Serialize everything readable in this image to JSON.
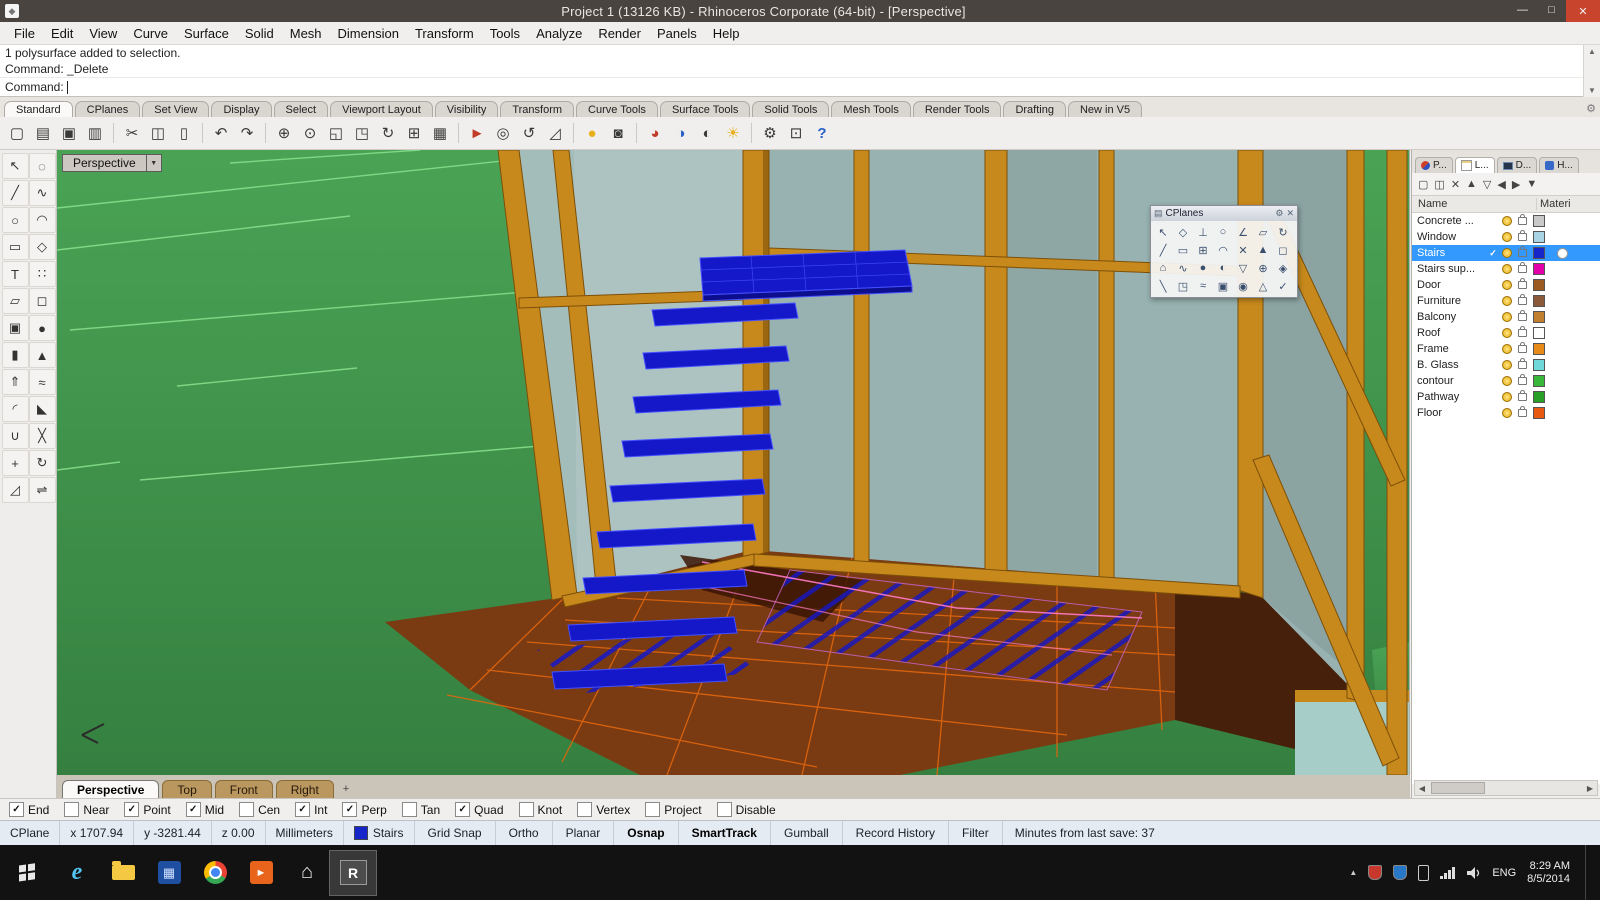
{
  "colors": {
    "titlebar": "#4a4441",
    "close": "#c8442c",
    "select": "#3399ff",
    "status-bg": "#e4ebf2",
    "taskbar": "#121212",
    "terrain": "#3f9048",
    "terrain-line": "#8ae28e",
    "glass": "#a3bdbb",
    "glass2": "#97b2b0",
    "wood": "#c8891c",
    "wood-dark": "#7c4f08",
    "floor": "#7a3a12",
    "floor-dark": "#46200a",
    "floor-line": "#e0660e",
    "stair": "#1518c8",
    "stair-edge": "#4550ff",
    "stair-dark": "#0c0e8e",
    "teal": "#a7cdc8",
    "pink": "#ff7ac8"
  },
  "window": {
    "title": "Project 1 (13126 KB) - Rhinoceros Corporate (64-bit) - [Perspective]",
    "controls": {
      "minimize": "—",
      "maximize": "□",
      "close": "✕"
    }
  },
  "menu": {
    "items": [
      "File",
      "Edit",
      "View",
      "Curve",
      "Surface",
      "Solid",
      "Mesh",
      "Dimension",
      "Transform",
      "Tools",
      "Analyze",
      "Render",
      "Panels",
      "Help"
    ]
  },
  "command": {
    "history": [
      "1 polysurface added to selection.",
      "Command: _Delete"
    ],
    "prompt": "Command:",
    "scroll_up": "▲",
    "scroll_down": "▼"
  },
  "toolbar_tabs": {
    "items": [
      "Standard",
      "CPlanes",
      "Set View",
      "Display",
      "Select",
      "Viewport Layout",
      "Visibility",
      "Transform",
      "Curve Tools",
      "Surface Tools",
      "Solid Tools",
      "Mesh Tools",
      "Render Tools",
      "Drafting",
      "New in V5"
    ],
    "active": "Standard",
    "options_glyph": "⚙"
  },
  "toolbar_icons": [
    {
      "name": "new-file-icon",
      "glyph": "▢"
    },
    {
      "name": "open-file-icon",
      "glyph": "▤"
    },
    {
      "name": "save-icon",
      "glyph": "▣"
    },
    {
      "name": "print-icon",
      "glyph": "▥"
    },
    {
      "name": "separator",
      "sep": true
    },
    {
      "name": "cut-icon",
      "glyph": "✂"
    },
    {
      "name": "copy-icon",
      "glyph": "◫"
    },
    {
      "name": "paste-icon",
      "glyph": "▯"
    },
    {
      "name": "separator",
      "sep": true
    },
    {
      "name": "undo-icon",
      "glyph": "↶"
    },
    {
      "name": "redo-icon",
      "glyph": "↷"
    },
    {
      "name": "separator",
      "sep": true
    },
    {
      "name": "pan-icon",
      "glyph": "⊕"
    },
    {
      "name": "zoom-icon",
      "glyph": "⊙"
    },
    {
      "name": "zoom-window-icon",
      "glyph": "◱"
    },
    {
      "name": "zoom-extents-icon",
      "glyph": "◳"
    },
    {
      "name": "rotate-view-icon",
      "glyph": "↻"
    },
    {
      "name": "viewport-layout-icon",
      "glyph": "⊞"
    },
    {
      "name": "named-cplane-icon",
      "glyph": "▦"
    },
    {
      "name": "separator",
      "sep": true
    },
    {
      "name": "move-icon",
      "glyph": "►",
      "cls": "red"
    },
    {
      "name": "copy-object-icon",
      "glyph": "◎"
    },
    {
      "name": "rotate-icon",
      "glyph": "↺"
    },
    {
      "name": "scale-icon",
      "glyph": "◿"
    },
    {
      "name": "separator",
      "sep": true
    },
    {
      "name": "lamp-icon",
      "glyph": "●",
      "cls": "yellow"
    },
    {
      "name": "lock-icon",
      "glyph": "◙"
    },
    {
      "name": "separator",
      "sep": true
    },
    {
      "name": "render-icon",
      "glyph": "◕",
      "cls": "red"
    },
    {
      "name": "render-preview-icon",
      "glyph": "◑",
      "cls": "blue"
    },
    {
      "name": "shaded-view-icon",
      "glyph": "◐"
    },
    {
      "name": "sun-icon",
      "glyph": "☀",
      "cls": "yellow"
    },
    {
      "name": "separator",
      "sep": true
    },
    {
      "name": "gear-icon",
      "glyph": "⚙"
    },
    {
      "name": "grid-options-icon",
      "glyph": "⊡"
    },
    {
      "name": "help-icon",
      "glyph": "?",
      "cls": "blue"
    }
  ],
  "left_tool_icons": [
    {
      "name": "pointer-icon",
      "glyph": "↖"
    },
    {
      "name": "lasso-select-icon",
      "glyph": "◌"
    },
    {
      "name": "polyline-icon",
      "glyph": "╱"
    },
    {
      "name": "control-curve-icon",
      "glyph": "∿"
    },
    {
      "name": "circle-icon",
      "glyph": "○"
    },
    {
      "name": "arc-icon",
      "glyph": "◠"
    },
    {
      "name": "rectangle-icon",
      "glyph": "▭"
    },
    {
      "name": "polygon-icon",
      "glyph": "◇"
    },
    {
      "name": "text-icon",
      "glyph": "T"
    },
    {
      "name": "points-icon",
      "glyph": "∷"
    },
    {
      "name": "surface-icon",
      "glyph": "▱"
    },
    {
      "name": "plane-icon",
      "glyph": "◻"
    },
    {
      "name": "box-icon",
      "glyph": "▣"
    },
    {
      "name": "sphere-icon",
      "glyph": "●"
    },
    {
      "name": "cylinder-icon",
      "glyph": "▮"
    },
    {
      "name": "cone-icon",
      "glyph": "▲"
    },
    {
      "name": "extrude-icon",
      "glyph": "⇑"
    },
    {
      "name": "loft-icon",
      "glyph": "≈"
    },
    {
      "name": "fillet-icon",
      "glyph": "◜"
    },
    {
      "name": "chamfer-icon",
      "glyph": "◣"
    },
    {
      "name": "boolean-union-icon",
      "glyph": "∪"
    },
    {
      "name": "trim-icon",
      "glyph": "╳"
    },
    {
      "name": "move-icon",
      "glyph": "+"
    },
    {
      "name": "rotate-icon",
      "glyph": "↻"
    },
    {
      "name": "scale-icon",
      "glyph": "◿"
    },
    {
      "name": "mirror-icon",
      "glyph": "⇌"
    }
  ],
  "viewport": {
    "label": "Perspective",
    "label_arrow": "▼",
    "cplanes": {
      "title": "CPlanes",
      "grip": "▤",
      "gear": "⚙",
      "close": "✕",
      "icons": [
        "↖",
        "◇",
        "⊥",
        "○",
        "∠",
        "▱",
        "↻",
        "╱",
        "▭",
        "⊞",
        "◠",
        "✕",
        "▲",
        "◻",
        "⌂",
        "∿",
        "●",
        "◐",
        "▽",
        "⊕",
        "◈",
        "╲",
        "◳",
        "≈",
        "▣",
        "◉",
        "△",
        "✓"
      ]
    }
  },
  "viewport_tabs": {
    "items": [
      "Perspective",
      "Top",
      "Front",
      "Right"
    ],
    "active": "Perspective",
    "add": "+"
  },
  "layers": {
    "panel_tabs": [
      {
        "label": "P..."
      },
      {
        "label": "L...",
        "active": true
      },
      {
        "label": "D..."
      },
      {
        "label": "H..."
      }
    ],
    "tools": [
      {
        "name": "new-layer-icon",
        "glyph": "▢"
      },
      {
        "name": "duplicate-layer-icon",
        "glyph": "◫"
      },
      {
        "name": "delete-layer-icon",
        "glyph": "✕"
      },
      {
        "name": "move-up-icon",
        "glyph": "▲"
      },
      {
        "name": "move-down-icon",
        "glyph": "▽"
      },
      {
        "name": "collapse-icon",
        "glyph": "◀"
      },
      {
        "name": "expand-icon",
        "glyph": "▶"
      },
      {
        "name": "filter-icon",
        "glyph": "▼"
      }
    ],
    "columns": {
      "name": "Name",
      "material": "Materi"
    },
    "check_glyph": "✓",
    "scroll": {
      "left": "◀",
      "right": "▶"
    },
    "rows": [
      {
        "name": "Concrete ...",
        "color": "#c9c9c9",
        "selected": false
      },
      {
        "name": "Window",
        "color": "#a8d4e4",
        "selected": false
      },
      {
        "name": "Stairs",
        "color": "#1626c9",
        "selected": true
      },
      {
        "name": "Stairs sup...",
        "color": "#e400a8",
        "selected": false
      },
      {
        "name": "Door",
        "color": "#9a5a22",
        "selected": false
      },
      {
        "name": "Furniture",
        "color": "#8a5a3a",
        "selected": false
      },
      {
        "name": "Balcony",
        "color": "#c08030",
        "selected": false
      },
      {
        "name": "Roof",
        "color": "#ffffff",
        "selected": false
      },
      {
        "name": "Frame",
        "color": "#e88a18",
        "selected": false
      },
      {
        "name": "B. Glass",
        "color": "#70d8d8",
        "selected": false
      },
      {
        "name": "contour",
        "color": "#38b838",
        "selected": false
      },
      {
        "name": "Pathway",
        "color": "#28a028",
        "selected": false
      },
      {
        "name": "Floor",
        "color": "#e85810",
        "selected": false
      }
    ]
  },
  "osnap": {
    "check_glyph": "✓",
    "items": [
      {
        "label": "End",
        "checked": true
      },
      {
        "label": "Near",
        "checked": false
      },
      {
        "label": "Point",
        "checked": true
      },
      {
        "label": "Mid",
        "checked": true
      },
      {
        "label": "Cen",
        "checked": false
      },
      {
        "label": "Int",
        "checked": true
      },
      {
        "label": "Perp",
        "checked": true
      },
      {
        "label": "Tan",
        "checked": false
      },
      {
        "label": "Quad",
        "checked": true
      },
      {
        "label": "Knot",
        "checked": false
      },
      {
        "label": "Vertex",
        "checked": false
      },
      {
        "label": "Project",
        "checked": false
      },
      {
        "label": "Disable",
        "checked": false
      }
    ]
  },
  "status": {
    "cplane": "CPlane",
    "x": "x 1707.94",
    "y": "y -3281.44",
    "z": "z 0.00",
    "units": "Millimeters",
    "layer": "Stairs",
    "layer_color": "#1626c9",
    "panes": [
      {
        "label": "Grid Snap",
        "active": false
      },
      {
        "label": "Ortho",
        "active": false
      },
      {
        "label": "Planar",
        "active": false
      },
      {
        "label": "Osnap",
        "active": true
      },
      {
        "label": "SmartTrack",
        "active": true
      },
      {
        "label": "Gumball",
        "active": false
      },
      {
        "label": "Record History",
        "active": false
      },
      {
        "label": "Filter",
        "active": false
      }
    ],
    "message": "Minutes from last save: 37"
  },
  "taskbar": {
    "apps": [
      {
        "name": "start-button"
      },
      {
        "name": "ie-icon",
        "glyph": "e"
      },
      {
        "name": "file-explorer-icon"
      },
      {
        "name": "pinned-app-icon",
        "glyph": "▦"
      },
      {
        "name": "chrome-icon"
      },
      {
        "name": "media-player-icon",
        "glyph": "►"
      },
      {
        "name": "home-icon",
        "glyph": "⌂"
      },
      {
        "name": "rhino-app-icon",
        "glyph": "R",
        "active": true
      }
    ],
    "tray": {
      "chevron": "▲",
      "lang": "ENG",
      "time": "8:29 AM",
      "date": "8/5/2014"
    }
  }
}
